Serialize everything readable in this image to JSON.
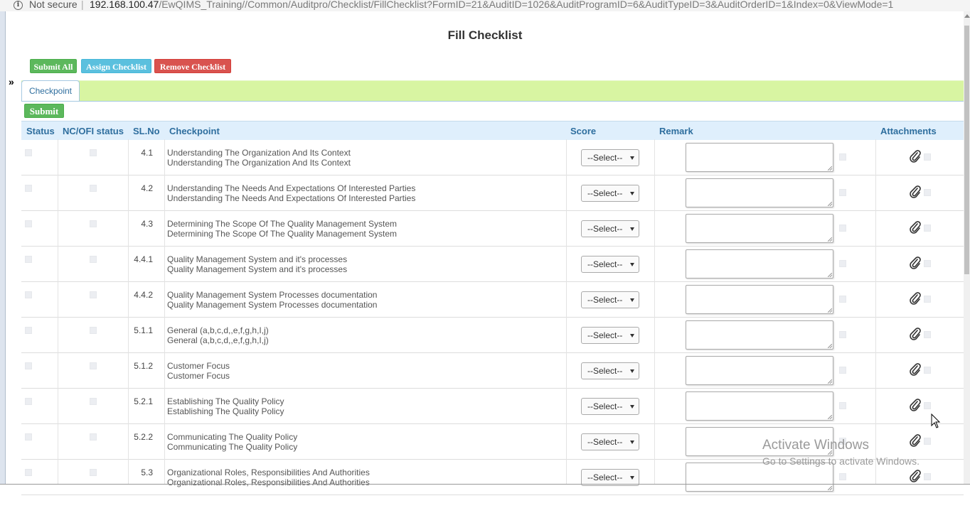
{
  "browser": {
    "security_label": "Not secure",
    "separator": "|",
    "url_host": "192.168.100.47",
    "url_path": "/EwQIMS_Training//Common/Auditpro/Checklist/FillChecklist?FormID=21&AuditID=1026&AuditProgramID=6&AuditTypeID=3&AuditOrderID=1&Index=0&ViewMode=1"
  },
  "page": {
    "title": "Fill Checklist",
    "toggle": "»"
  },
  "toolbar": {
    "submit_all": "Submit All",
    "assign_checklist": "Assign Checklist",
    "remove_checklist": "Remove Checklist"
  },
  "tabs": [
    {
      "label": "Checkpoint"
    }
  ],
  "form": {
    "submit_label": "Submit"
  },
  "table": {
    "columns": {
      "status": "Status",
      "nc_ofi": "NC/OFI status",
      "slno": "SL.No",
      "checkpoint": "Checkpoint",
      "score": "Score",
      "remark": "Remark",
      "attachments": "Attachments"
    },
    "select_placeholder": "--Select--",
    "rows": [
      {
        "slno": "4.1",
        "line1": "Understanding The Organization And Its Context",
        "line2": "Understanding The Organization And Its Context"
      },
      {
        "slno": "4.2",
        "line1": "Understanding The Needs And Expectations Of Interested Parties",
        "line2": "Understanding The Needs And Expectations Of Interested Parties"
      },
      {
        "slno": "4.3",
        "line1": "Determining The Scope Of The Quality Management System",
        "line2": "Determining The Scope Of The Quality Management System"
      },
      {
        "slno": "4.4.1",
        "line1": "Quality Management System and it's processes",
        "line2": "Quality Management System and it's processes"
      },
      {
        "slno": "4.4.2",
        "line1": "Quality Management System Processes documentation",
        "line2": "Quality Management System Processes documentation"
      },
      {
        "slno": "5.1.1",
        "line1": "General (a,b,c,d,,e,f,g,h,I,j)",
        "line2": "General (a,b,c,d,,e,f,g,h,I,j)"
      },
      {
        "slno": "5.1.2",
        "line1": "Customer Focus",
        "line2": "Customer Focus"
      },
      {
        "slno": "5.2.1",
        "line1": "Establishing The Quality Policy",
        "line2": "Establishing The Quality Policy"
      },
      {
        "slno": "5.2.2",
        "line1": "Communicating The Quality Policy",
        "line2": "Communicating The Quality Policy"
      },
      {
        "slno": "5.3",
        "line1": "Organizational Roles, Responsibilities And Authorities",
        "line2": "Organizational Roles, Responsibilities And Authorities"
      }
    ]
  },
  "watermark": {
    "line1": "Activate Windows",
    "line2": "Go to Settings to activate Windows."
  },
  "icons": {
    "attachment": "paperclip-icon",
    "info": "info-icon",
    "cursor": "mouse-cursor-icon"
  }
}
